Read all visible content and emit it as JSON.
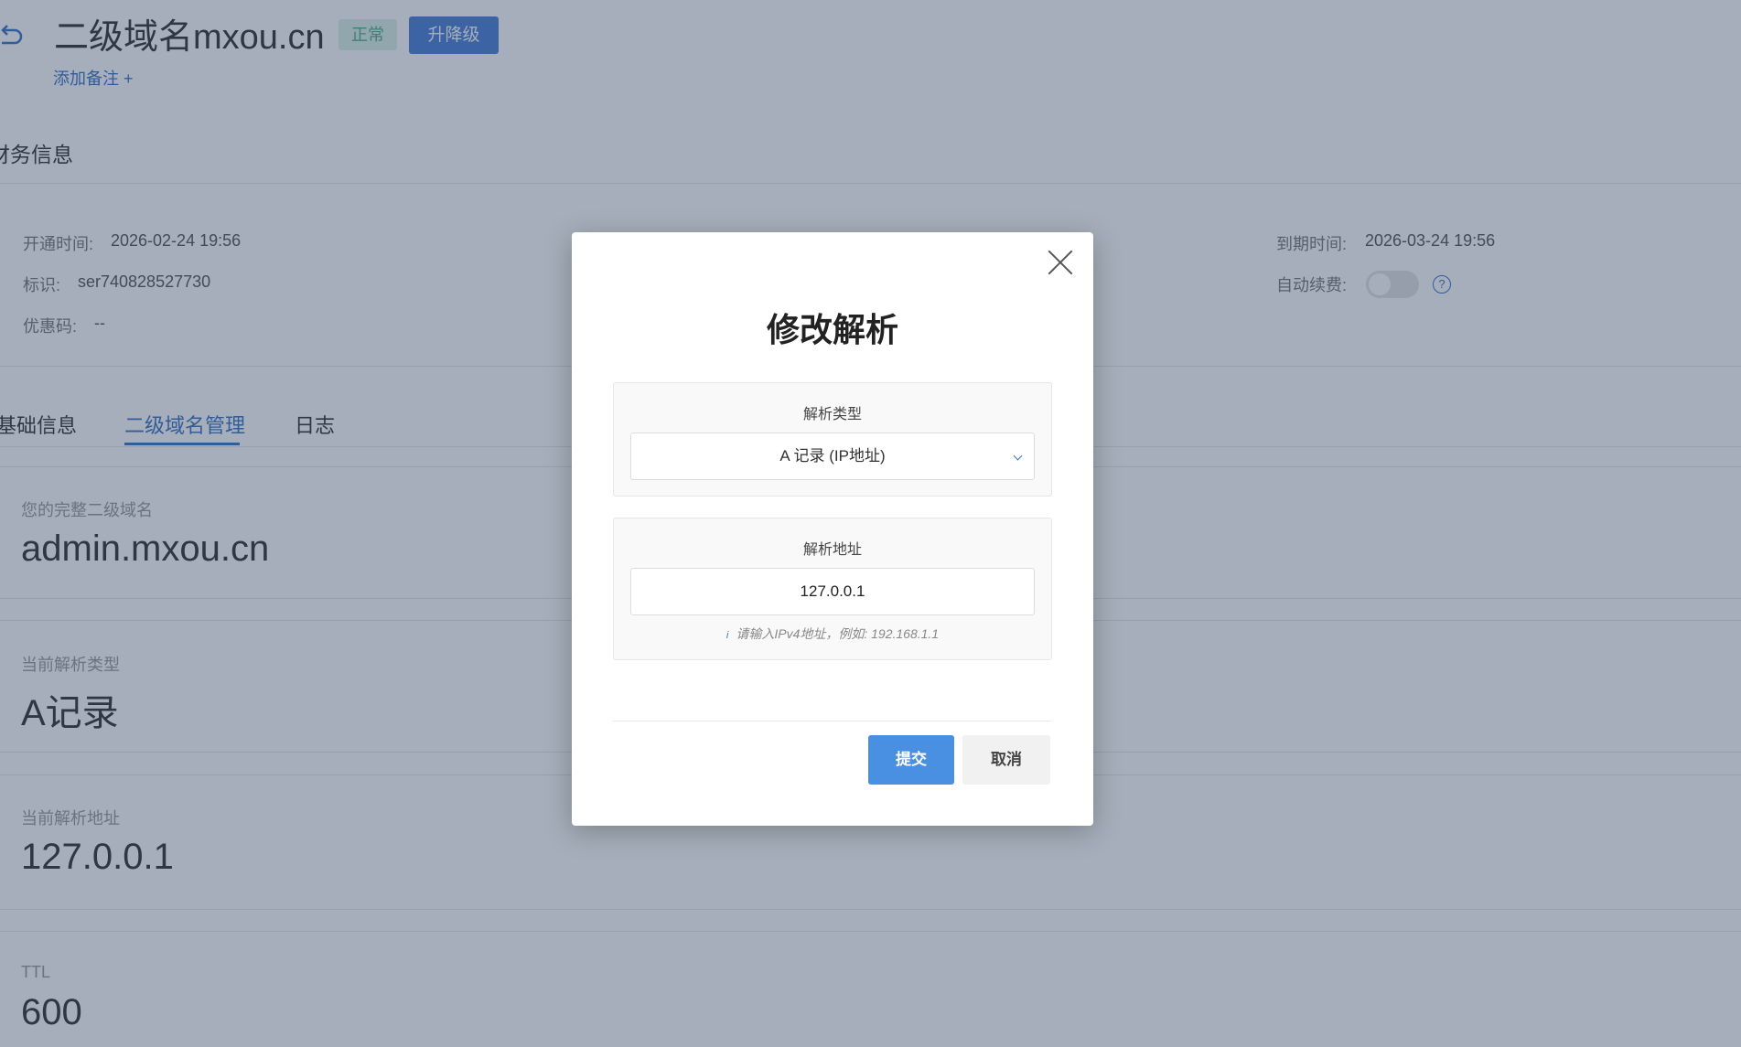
{
  "header": {
    "title": "二级域名mxou.cn",
    "status": "正常",
    "upgrade_label": "升降级",
    "add_note": "添加备注 +"
  },
  "finance": {
    "section_title": "财务信息",
    "open_time_label": "开通时间:",
    "open_time_value": "2026-02-24 19:56",
    "id_label": "标识:",
    "id_value": "ser740828527730",
    "coupon_label": "优惠码:",
    "coupon_value": "--",
    "expire_label": "到期时间:",
    "expire_value": "2026-03-24 19:56",
    "auto_renew_label": "自动续费:",
    "auto_renew_on": false
  },
  "tabs": [
    {
      "label": "基础信息",
      "active": false
    },
    {
      "label": "二级域名管理",
      "active": true
    },
    {
      "label": "日志",
      "active": false
    }
  ],
  "cards": [
    {
      "label": "您的完整二级域名",
      "value": "admin.mxou.cn"
    },
    {
      "label": "当前解析类型",
      "value": "A记录"
    },
    {
      "label": "当前解析地址",
      "value": "127.0.0.1"
    },
    {
      "label": "TTL",
      "value": "600"
    }
  ],
  "modal": {
    "title": "修改解析",
    "type_label": "解析类型",
    "type_selected": "A 记录 (IP地址)",
    "address_label": "解析地址",
    "address_value": "127.0.0.1",
    "hint_icon": "i",
    "hint": "请输入IPv4地址，例如: 192.168.1.1",
    "submit_label": "提交",
    "cancel_label": "取消"
  },
  "colors": {
    "accent": "#4a7fd9",
    "overlay": "rgba(40,62,90,0.42)",
    "status_bg": "#dff2ea",
    "status_text": "#4fb08a"
  }
}
